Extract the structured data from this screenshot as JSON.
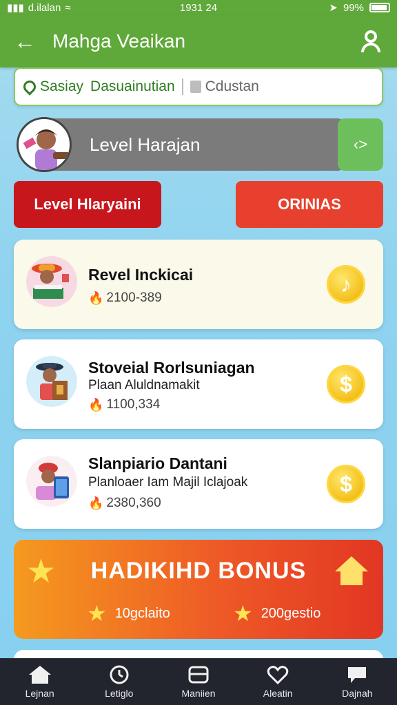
{
  "status_bar": {
    "carrier": "d.ilalan",
    "time": "1931 24",
    "battery": "99%"
  },
  "app_bar": {
    "title": "Mahga Veaikan",
    "back_icon": "back-arrow-icon",
    "profile_icon": "user-icon"
  },
  "filters": [
    {
      "label": "Sasiay",
      "icon": "tag-icon"
    },
    {
      "label": "Dasuainutian",
      "icon": ""
    },
    {
      "label": "Cdustan",
      "icon": "box-icon"
    }
  ],
  "level": {
    "label": "Level Harajan",
    "next_label": "‹>"
  },
  "buttons": {
    "left_label": "Level Hlaryaini",
    "right_label": "ORINIAS"
  },
  "cards": [
    {
      "name": "Revel Inckicai",
      "subtitle": "",
      "price": "2100-389",
      "coin_symbol": "♪"
    },
    {
      "name": "Stoveial Rorlsuniagan",
      "subtitle": "Plaan Aluldnamakit",
      "price": "1100,334",
      "coin_symbol": "$"
    },
    {
      "name": "Slanpiario Dantani",
      "subtitle": "Planloaer Iam Majil Iclajoak",
      "price": "2380,360",
      "coin_symbol": "$"
    }
  ],
  "bonus": {
    "title": "HADIKIHD BONUS",
    "item1": "10gclaito",
    "item2": "200gestio"
  },
  "bottom_nav": [
    {
      "label": "Lejnan",
      "icon": "home-icon"
    },
    {
      "label": "Letiglo",
      "icon": "clock-icon"
    },
    {
      "label": "Maniien",
      "icon": "tray-icon"
    },
    {
      "label": "Aleatin",
      "icon": "heart-icon"
    },
    {
      "label": "Dajnah",
      "icon": "chat-icon"
    }
  ],
  "colors": {
    "app_green": "#5fa83a",
    "red": "#c8161d",
    "orange_red": "#e8402e",
    "coin_gold": "#f2bd14",
    "nav_bg": "#22252e"
  }
}
